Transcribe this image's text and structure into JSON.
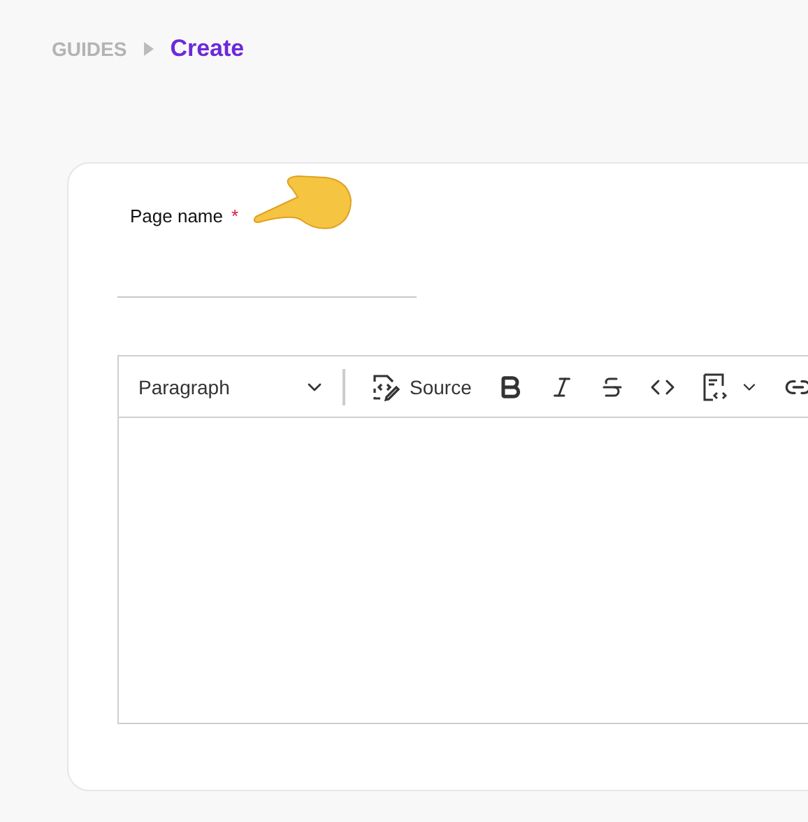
{
  "breadcrumb": [
    {
      "label": "GUIDES",
      "selected": false
    },
    {
      "label": "Create",
      "selected": true
    }
  ],
  "form": {
    "field": {
      "label": "Page name",
      "required": "*"
    },
    "editor": {
      "block_format": "Paragraph",
      "toolbar": [
        {
          "kind": "source",
          "label": "Source"
        },
        {
          "kind": "bold"
        },
        {
          "kind": "italic"
        },
        {
          "kind": "strike"
        },
        {
          "kind": "code"
        },
        {
          "kind": "codeblock"
        },
        {
          "kind": "link"
        }
      ]
    }
  }
}
